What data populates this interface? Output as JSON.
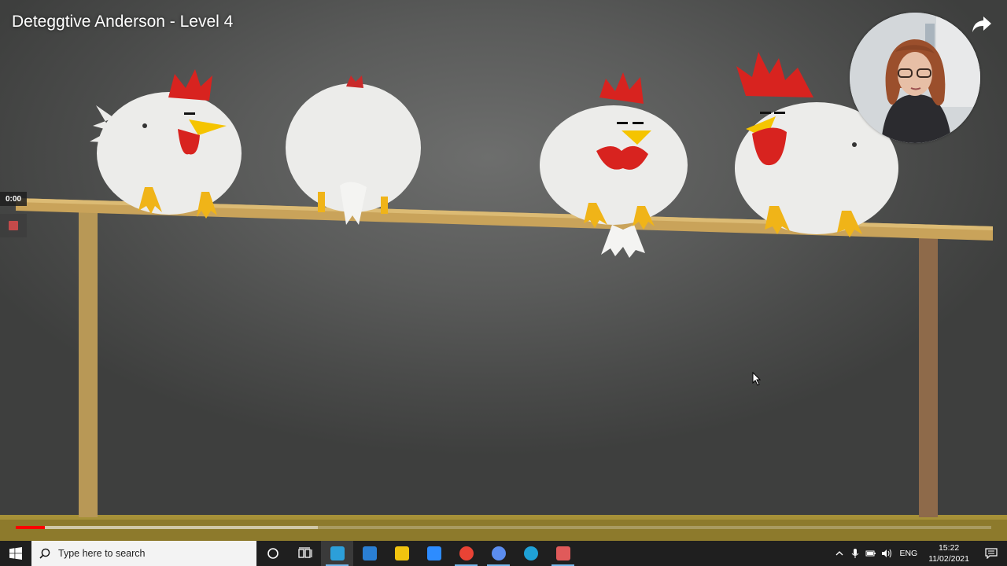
{
  "video": {
    "title": "Deteggtive Anderson - Level 4",
    "elapsed": "0:00",
    "progress_played": 0.03,
    "progress_loaded": 0.31
  },
  "icons": {
    "share": "share-arrow-icon",
    "stop": "stop-record-icon",
    "start": "windows-logo-icon",
    "search": "search-icon",
    "cortana": "cortana-circle-icon",
    "taskview": "task-view-icon",
    "notifications": "notification-icon"
  },
  "taskbar": {
    "search_placeholder": "Type here to search",
    "apps": [
      {
        "name": "notepad-app-icon",
        "color": "#2c9fd9",
        "state": "active"
      },
      {
        "name": "mail-app-icon",
        "color": "#2a7fd4",
        "state": "none"
      },
      {
        "name": "file-explorer-app-icon",
        "color": "#f1c40f",
        "state": "none"
      },
      {
        "name": "zoom-app-icon",
        "color": "#2d8cff",
        "state": "none"
      },
      {
        "name": "chrome-app-icon",
        "color": "#e94335",
        "state": "running"
      },
      {
        "name": "settings-app-icon",
        "color": "#5b8def",
        "state": "running"
      },
      {
        "name": "edge-app-icon",
        "color": "#1fa1d6",
        "state": "none"
      },
      {
        "name": "snipping-app-icon",
        "color": "#e05a5a",
        "state": "running"
      }
    ],
    "language": "ENG",
    "time": "15:22",
    "date": "11/02/2021"
  },
  "colors": {
    "accent": "#ff0000",
    "taskbar": "#1f1f1f",
    "comb": "#d8231f",
    "beak": "#f5c400",
    "perch": "#c9a35a"
  }
}
